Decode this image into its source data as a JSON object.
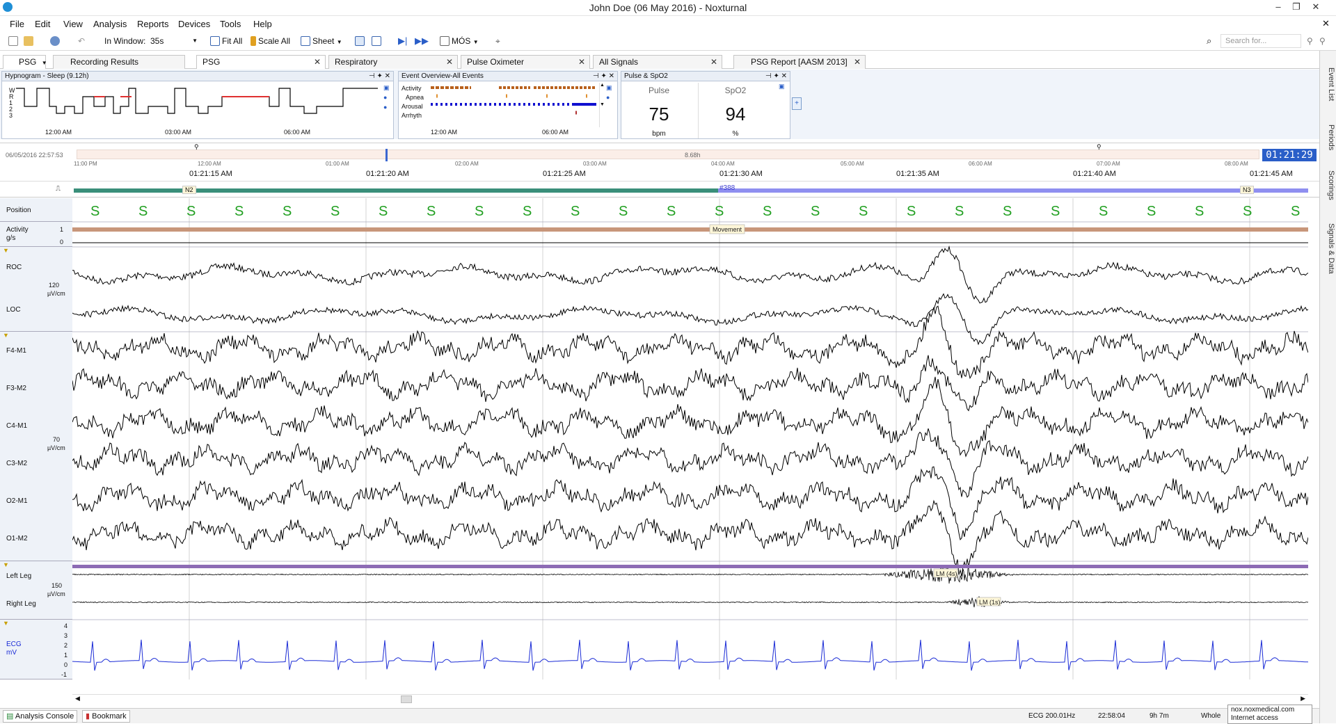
{
  "window": {
    "title": "John Doe (06 May 2016)  - Noxturnal"
  },
  "menu": [
    "File",
    "Edit",
    "View",
    "Analysis",
    "Reports",
    "Devices",
    "Tools",
    "Help"
  ],
  "toolbar": {
    "in_window_label": "In Window:",
    "in_window_value": "35s",
    "fit_all": "Fit All",
    "scale_all": "Scale All",
    "sheet": "Sheet",
    "mos": "MÓS",
    "search_placeholder": "Search for..."
  },
  "tabs": {
    "selector": "PSG",
    "items": [
      {
        "label": "Recording Results"
      },
      {
        "label": "PSG"
      },
      {
        "label": "Respiratory"
      },
      {
        "label": "Pulse Oximeter"
      },
      {
        "label": "All Signals"
      },
      {
        "label": "PSG Report [AASM 2013]"
      }
    ]
  },
  "hypnogram": {
    "title": "Hypnogram - Sleep (9.12h)",
    "levels": [
      "W",
      "R",
      "1",
      "2",
      "3"
    ],
    "times": [
      "12:00 AM",
      "03:00 AM",
      "06:00 AM"
    ]
  },
  "event_overview": {
    "title": "Event Overview-All Events",
    "rows": [
      "Activity",
      "Apnea",
      "Arousal",
      "Arrhyth"
    ],
    "times": [
      "12:00 AM",
      "06:00 AM"
    ]
  },
  "pulse_spo2": {
    "title": "Pulse & SpO2",
    "pulse_label": "Pulse",
    "pulse_value": "75",
    "pulse_unit": "bpm",
    "spo2_label": "SpO2",
    "spo2_value": "94",
    "spo2_unit": "%"
  },
  "navigation": {
    "start": "06/05/2016 22:57:53",
    "duration": "8.68h",
    "clock": "01:21:29",
    "ticks": [
      "11:00 PM",
      "12:00 AM",
      "01:00 AM",
      "02:00 AM",
      "03:00 AM",
      "04:00 AM",
      "05:00 AM",
      "06:00 AM",
      "07:00 AM",
      "08:00 AM"
    ]
  },
  "time_axis": [
    "01:21:15 AM",
    "01:21:20 AM",
    "01:21:25 AM",
    "01:21:30 AM",
    "01:21:35 AM",
    "01:21:40 AM",
    "01:21:45 AM"
  ],
  "stages": {
    "left": "N2",
    "mid": "#388",
    "right": "N3"
  },
  "position": {
    "label": "Position",
    "symbol": "S",
    "count": 26
  },
  "activity": {
    "label": "Activity",
    "unit": "g/s",
    "scale_top": "1",
    "scale_bottom": "0",
    "event": "Movement"
  },
  "eog": {
    "channels": [
      "ROC",
      "LOC"
    ],
    "scale": "120",
    "unit": "µV/cm"
  },
  "eeg": {
    "channels": [
      "F4-M1",
      "F3-M2",
      "C4-M1",
      "C3-M2",
      "O2-M1",
      "O1-M2"
    ],
    "scale": "70",
    "unit": "µV/cm"
  },
  "legs": {
    "channels": [
      "Left Leg",
      "Right Leg"
    ],
    "scale": "150",
    "unit": "µV/cm",
    "left_event": "LM (4s)",
    "right_event": "LM (1s)"
  },
  "ecg": {
    "label": "ECG",
    "unit": "mV",
    "ticks": [
      "4",
      "3",
      "2",
      "1",
      "0",
      "-1"
    ]
  },
  "status": {
    "console": "Analysis Console",
    "bookmark": "Bookmark",
    "ecg": "ECG 200.01Hz",
    "time": "22:58:04",
    "duration": "9h 7m",
    "whole": "Whole",
    "tooltip_url": "nox.noxmedical.com",
    "tooltip_sub": "Internet access"
  },
  "right_tabs": [
    "Event List",
    "Periods",
    "Scorings",
    "Signals & Data"
  ],
  "colors": {
    "eeg": "#000000",
    "ecg": "#1a2bd6",
    "stage_n2": "#3a8f7a",
    "stage_other": "#8f8ff0",
    "position": "#22a022",
    "activity": "#c8967a",
    "legs_bar": "#8d6bb5",
    "event_brown": "#b8601c",
    "event_blue": "#1010d0"
  }
}
